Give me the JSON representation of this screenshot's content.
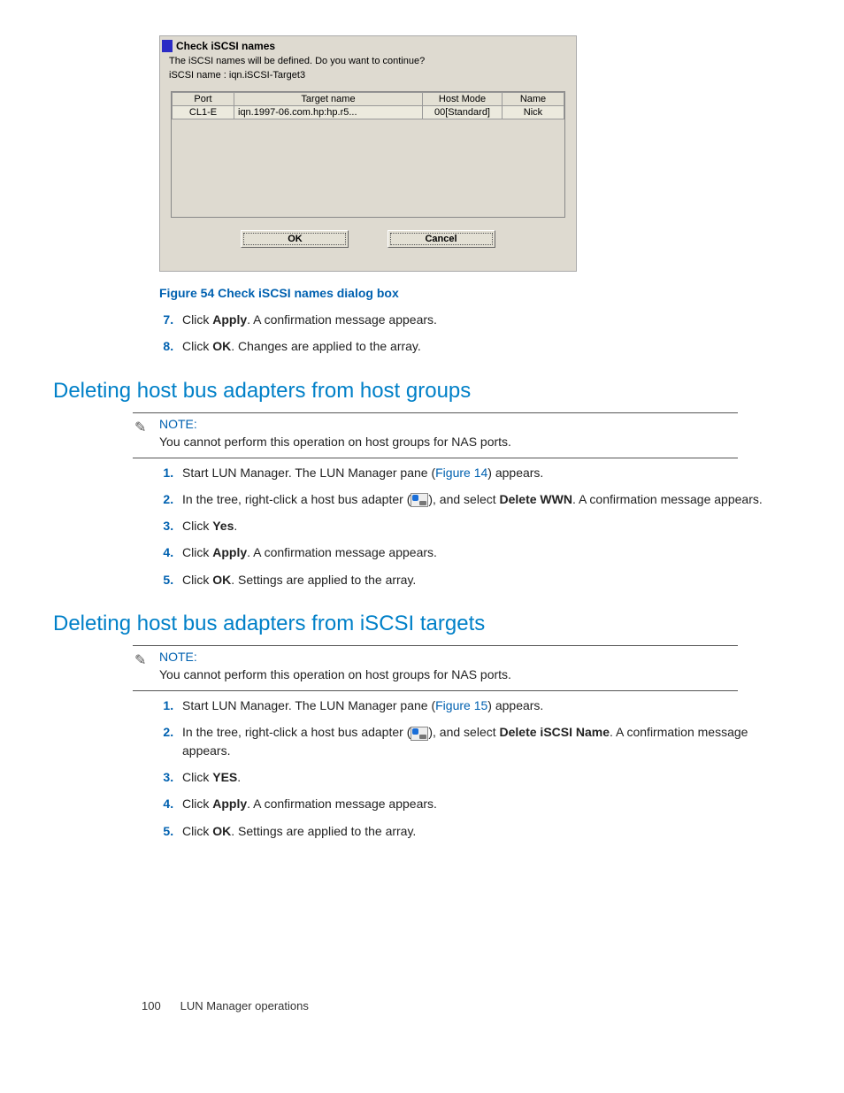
{
  "dialog": {
    "title": "Check iSCSI names",
    "message": "The iSCSI names will be defined. Do you want to continue?",
    "name_label": "iSCSI name :",
    "name_value": "iqn.iSCSI-Target3",
    "columns": {
      "c1": "Port",
      "c2": "Target name",
      "c3": "Host Mode",
      "c4": "Name"
    },
    "row": {
      "port": "CL1-E",
      "target": "iqn.1997-06.com.hp:hp.r5...",
      "mode": "00[Standard]",
      "name": "Nick"
    },
    "ok": "OK",
    "cancel": "Cancel"
  },
  "figure_caption": "Figure 54 Check iSCSI names dialog box",
  "top_steps": {
    "s7a": "Click ",
    "s7b": "Apply",
    "s7c": ". A confirmation message appears.",
    "s8a": "Click ",
    "s8b": "OK",
    "s8c": ". Changes are applied to the array."
  },
  "section1": {
    "title": "Deleting host bus adapters from host groups",
    "note_label": "NOTE:",
    "note_text": "You cannot perform this operation on host groups for NAS ports.",
    "steps": {
      "s1a": "Start LUN Manager. The LUN Manager pane (",
      "s1link": "Figure 14",
      "s1b": ") appears.",
      "s2a": "In the tree, right-click a host bus adapter (",
      "s2b": "), and select ",
      "s2bold": "Delete WWN",
      "s2c": ". A confirmation message appears.",
      "s3a": "Click ",
      "s3b": "Yes",
      "s3c": ".",
      "s4a": "Click ",
      "s4b": "Apply",
      "s4c": ". A confirmation message appears.",
      "s5a": "Click ",
      "s5b": "OK",
      "s5c": ". Settings are applied to the array."
    }
  },
  "section2": {
    "title": "Deleting host bus adapters from iSCSI targets",
    "note_label": "NOTE:",
    "note_text": "You cannot perform this operation on host groups for NAS ports.",
    "steps": {
      "s1a": "Start LUN Manager. The LUN Manager pane (",
      "s1link": "Figure 15",
      "s1b": ") appears.",
      "s2a": "In the tree, right-click a host bus adapter (",
      "s2b": "), and select ",
      "s2bold": "Delete iSCSI Name",
      "s2c": ". A confirmation message appears.",
      "s3a": "Click ",
      "s3b": "YES",
      "s3c": ".",
      "s4a": "Click ",
      "s4b": "Apply",
      "s4c": ". A confirmation message appears.",
      "s5a": "Click ",
      "s5b": "OK",
      "s5c": ". Settings are applied to the array."
    }
  },
  "footer": {
    "page": "100",
    "section": "LUN Manager operations"
  }
}
